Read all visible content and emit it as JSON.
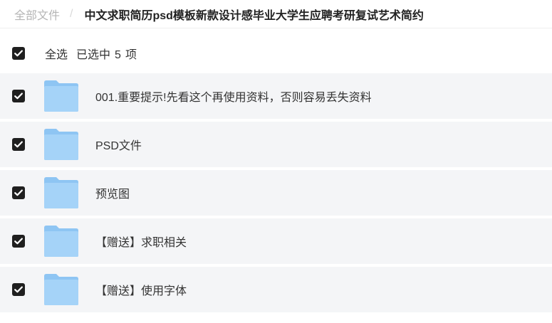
{
  "breadcrumb": {
    "root": "全部文件",
    "separator": "/",
    "current": "中文求职简历psd模板新款设计感毕业大学生应聘考研复试艺术简约"
  },
  "selection": {
    "select_all_label": "全选",
    "selected_prefix": "已选中",
    "selected_count": "5",
    "selected_suffix": "项"
  },
  "files": [
    {
      "name": "001.重要提示!先看这个再使用资料，否则容易丢失资料",
      "type": "folder",
      "checked": true
    },
    {
      "name": "PSD文件",
      "type": "folder",
      "checked": true
    },
    {
      "name": "预览图",
      "type": "folder",
      "checked": true
    },
    {
      "name": "【赠送】求职相关",
      "type": "folder",
      "checked": true
    },
    {
      "name": "【赠送】使用字体",
      "type": "folder",
      "checked": true
    }
  ],
  "icons": {
    "folder": "folder-icon",
    "checkbox": "checkbox-checked-icon"
  },
  "colors": {
    "folder_body": "#8ec5f3",
    "folder_front": "#a5d3f8",
    "checkbox": "#1f1f1f",
    "row_background": "#f4f5f7"
  }
}
